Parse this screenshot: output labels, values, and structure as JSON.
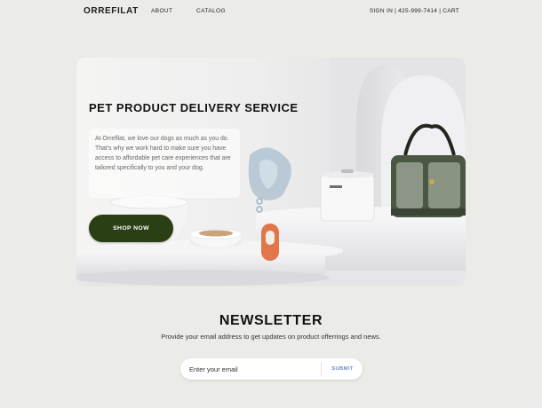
{
  "header": {
    "logo": "ORREFILAT",
    "nav": [
      {
        "label": "ABOUT"
      },
      {
        "label": "CATALOG"
      }
    ],
    "account": {
      "sign_in": "SIGN IN",
      "separator": "|",
      "phone": "425-999-7414",
      "cart": "CART"
    }
  },
  "hero": {
    "title": "PET PRODUCT DELIVERY SERVICE",
    "description": "At Orrefilat, we love our dogs as much as you do. That's why we work hard to make sure you have access to affordable pet care experiences that are tailored specifically to you and your dog.",
    "cta_label": "SHOP NOW",
    "cta_color": "#2b3f15",
    "product_label": "Orrefilat"
  },
  "newsletter": {
    "title": "NEWSLETTER",
    "subtitle": "Provide your email address to get updates on product offerrings and news.",
    "email_placeholder": "Enter your email",
    "submit_label": "SUBMIT",
    "submit_color": "#6a8cc7"
  }
}
